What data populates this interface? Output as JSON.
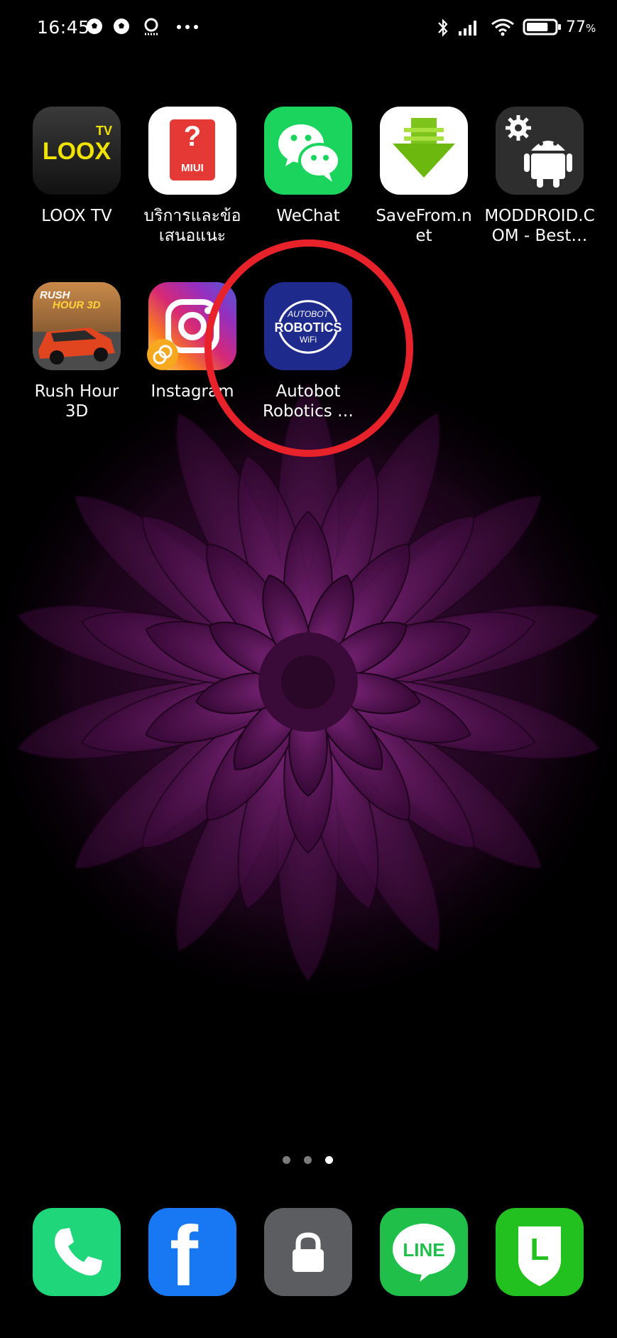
{
  "status_bar": {
    "time": "16:45",
    "battery_percent": "77",
    "battery_unit": "%",
    "battery_level": 0.77,
    "left_icons": [
      "soccer-ball-icon",
      "soccer-ball-icon",
      "tool-notification-icon",
      "more-dots-icon"
    ],
    "right_icons": [
      "bluetooth-icon",
      "signal-icon",
      "wifi-icon",
      "battery-icon"
    ]
  },
  "apps": [
    {
      "label": "LOOX TV",
      "icon_text": "LOOX",
      "icon_badge": "TV",
      "icon": "loox-tv-icon"
    },
    {
      "label": "บริการและข้อ\nเสนอแนะ",
      "icon_text": "MIUI",
      "icon_symbol": "?",
      "icon": "miui-feedback-icon"
    },
    {
      "label": "WeChat",
      "icon": "wechat-icon"
    },
    {
      "label": "SaveFrom.n\net",
      "icon": "savefrom-download-icon"
    },
    {
      "label": "MODDROID.C\nOM - Best…",
      "icon": "moddroid-android-icon"
    },
    {
      "label": "Rush Hour\n3D",
      "icon_text_1": "RUSH",
      "icon_text_2": "HOUR 3D",
      "icon": "rush-hour-3d-icon"
    },
    {
      "label": "Instagram",
      "icon": "instagram-icon"
    },
    {
      "label": "Autobot\nRobotics …",
      "icon_text_1": "AUTOBOT",
      "icon_text_2": "ROBOTICS",
      "icon_text_3": "WiFi",
      "icon": "autobot-robotics-icon"
    }
  ],
  "highlight": {
    "color": "#e8222b",
    "target": "Autobot Robotics …"
  },
  "page_indicator": {
    "pages": 3,
    "current": 3
  },
  "dock": [
    {
      "icon": "phone-icon",
      "color": "#1fd67a"
    },
    {
      "icon": "facebook-icon",
      "color": "#1877f2",
      "icon_text": "f"
    },
    {
      "icon": "lock-icon",
      "color": "#5b5d61"
    },
    {
      "icon": "line-icon",
      "color": "#1fbf4a",
      "icon_text": "LINE"
    },
    {
      "icon": "line-official-icon",
      "color": "#22c11f",
      "icon_text": "L"
    }
  ]
}
